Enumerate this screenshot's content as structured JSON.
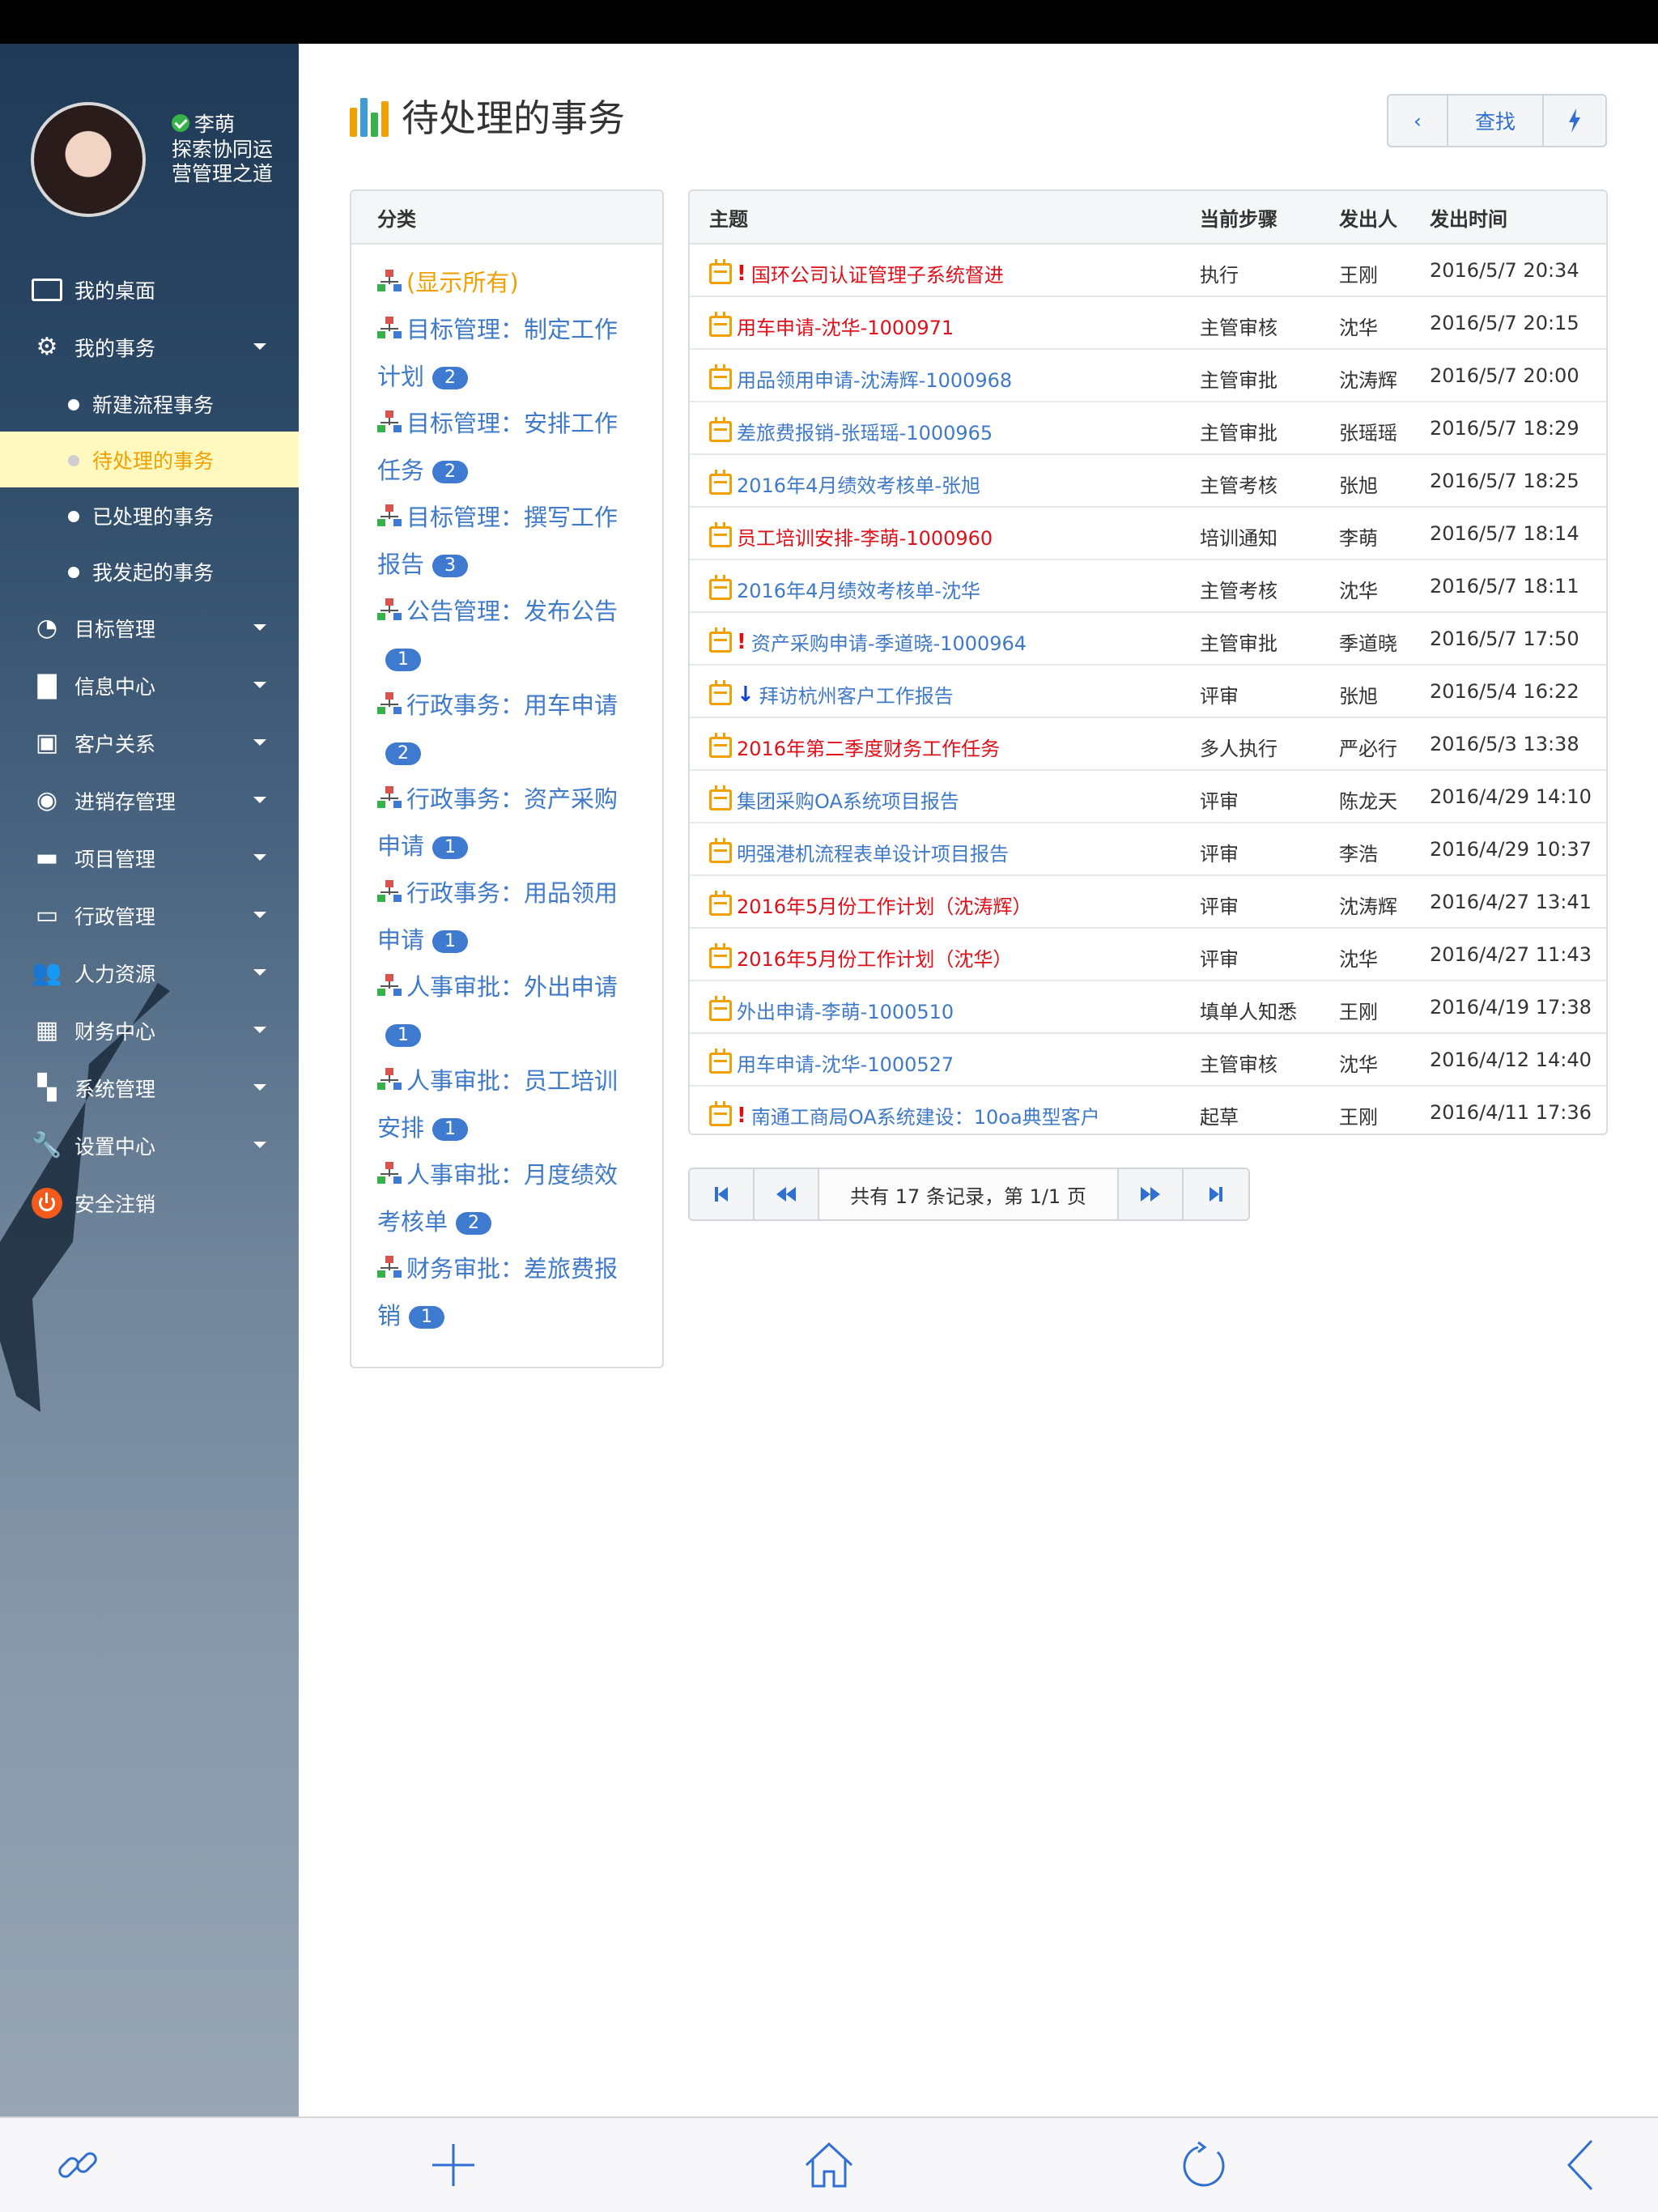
{
  "user": {
    "name": "李萌",
    "motto": "探索协同运营管理之道"
  },
  "nav": {
    "desktop": "我的桌面",
    "my_tasks": "我的事务",
    "sub": [
      "新建流程事务",
      "待处理的事务",
      "已处理的事务",
      "我发起的事务"
    ],
    "items": [
      "目标管理",
      "信息中心",
      "客户关系",
      "进销存管理",
      "项目管理",
      "行政管理",
      "人力资源",
      "财务中心",
      "系统管理",
      "设置中心"
    ],
    "logout": "安全注销"
  },
  "page": {
    "title": "待处理的事务"
  },
  "toolbar": {
    "back": "‹",
    "search": "查找"
  },
  "categories": {
    "header": "分类",
    "items": [
      {
        "label": "(显示所有)",
        "count": ""
      },
      {
        "label": "目标管理：制定工作计划",
        "count": "2"
      },
      {
        "label": "目标管理：安排工作任务",
        "count": "2"
      },
      {
        "label": "目标管理：撰写工作报告",
        "count": "3"
      },
      {
        "label": "公告管理：发布公告",
        "count": "1"
      },
      {
        "label": "行政事务：用车申请",
        "count": "2"
      },
      {
        "label": "行政事务：资产采购申请",
        "count": "1"
      },
      {
        "label": "行政事务：用品领用申请",
        "count": "1"
      },
      {
        "label": "人事审批：外出申请",
        "count": "1"
      },
      {
        "label": "人事审批：员工培训安排",
        "count": "1"
      },
      {
        "label": "人事审批：月度绩效考核单",
        "count": "2"
      },
      {
        "label": "财务审批：差旅费报销",
        "count": "1"
      }
    ]
  },
  "tasks": {
    "headers": {
      "subject": "主题",
      "step": "当前步骤",
      "sender": "发出人",
      "time": "发出时间"
    },
    "rows": [
      {
        "subject": "国环公司认证管理子系统督进",
        "step": "执行",
        "sender": "王刚",
        "time": "2016/5/7 20:34",
        "color": "red",
        "flag": "!"
      },
      {
        "subject": "用车申请-沈华-1000971",
        "step": "主管审核",
        "sender": "沈华",
        "time": "2016/5/7 20:15",
        "color": "red",
        "flag": ""
      },
      {
        "subject": "用品领用申请-沈涛辉-1000968",
        "step": "主管审批",
        "sender": "沈涛辉",
        "time": "2016/5/7 20:00",
        "color": "blue",
        "flag": ""
      },
      {
        "subject": "差旅费报销-张瑶瑶-1000965",
        "step": "主管审批",
        "sender": "张瑶瑶",
        "time": "2016/5/7 18:29",
        "color": "blue",
        "flag": ""
      },
      {
        "subject": "2016年4月绩效考核单-张旭",
        "step": "主管考核",
        "sender": "张旭",
        "time": "2016/5/7 18:25",
        "color": "blue",
        "flag": ""
      },
      {
        "subject": "员工培训安排-李萌-1000960",
        "step": "培训通知",
        "sender": "李萌",
        "time": "2016/5/7 18:14",
        "color": "red",
        "flag": ""
      },
      {
        "subject": "2016年4月绩效考核单-沈华",
        "step": "主管考核",
        "sender": "沈华",
        "time": "2016/5/7 18:11",
        "color": "blue",
        "flag": ""
      },
      {
        "subject": "资产采购申请-季道晓-1000964",
        "step": "主管审批",
        "sender": "季道晓",
        "time": "2016/5/7 17:50",
        "color": "blue",
        "flag": "!"
      },
      {
        "subject": "拜访杭州客户工作报告",
        "step": "评审",
        "sender": "张旭",
        "time": "2016/5/4 16:22",
        "color": "blue",
        "flag": "↓"
      },
      {
        "subject": "2016年第二季度财务工作任务",
        "step": "多人执行",
        "sender": "严必行",
        "time": "2016/5/3 13:38",
        "color": "red",
        "flag": ""
      },
      {
        "subject": "集团采购OA系统项目报告",
        "step": "评审",
        "sender": "陈龙天",
        "time": "2016/4/29 14:10",
        "color": "blue",
        "flag": ""
      },
      {
        "subject": "明强港机流程表单设计项目报告",
        "step": "评审",
        "sender": "李浩",
        "time": "2016/4/29 10:37",
        "color": "blue",
        "flag": ""
      },
      {
        "subject": "2016年5月份工作计划（沈涛辉）",
        "step": "评审",
        "sender": "沈涛辉",
        "time": "2016/4/27 13:41",
        "color": "red",
        "flag": ""
      },
      {
        "subject": "2016年5月份工作计划（沈华）",
        "step": "评审",
        "sender": "沈华",
        "time": "2016/4/27 11:43",
        "color": "red",
        "flag": ""
      },
      {
        "subject": "外出申请-李萌-1000510",
        "step": "填单人知悉",
        "sender": "王刚",
        "time": "2016/4/19 17:38",
        "color": "blue",
        "flag": ""
      },
      {
        "subject": "用车申请-沈华-1000527",
        "step": "主管审核",
        "sender": "沈华",
        "time": "2016/4/12 14:40",
        "color": "blue",
        "flag": ""
      },
      {
        "subject": "南通工商局OA系统建设：10oa典型客户",
        "step": "起草",
        "sender": "王刚",
        "time": "2016/4/11 17:36",
        "color": "blue",
        "flag": "!"
      }
    ]
  },
  "pager": {
    "info": "共有 17 条记录，第 1/1 页"
  },
  "colors": {
    "accent": "#3f7ac9",
    "urgent": "#e0101a",
    "active_bg": "#fff9bf",
    "active_text": "#f0a000"
  }
}
